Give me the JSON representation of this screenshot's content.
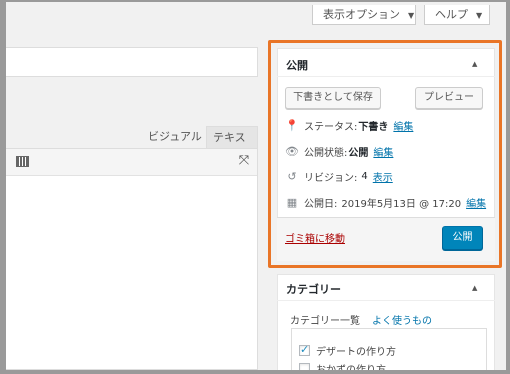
{
  "top": {
    "screen_options": "表示オプション",
    "help": "ヘルプ"
  },
  "editor": {
    "tab_visual": "ビジュアル",
    "tab_text": "テキスト"
  },
  "publish": {
    "title": "公開",
    "save_draft": "下書きとして保存",
    "preview": "プレビュー",
    "status_label": "ステータス:",
    "status_value": "下書き",
    "visibility_label": "公開状態:",
    "visibility_value": "公開",
    "revisions_label": "リビジョン:",
    "revisions_value": "4",
    "revisions_link": "表示",
    "date_label": "公開日:",
    "date_value": "2019年5月13日 @ 17:20",
    "edit": "編集",
    "trash": "ゴミ箱に移動",
    "publish_button": "公開",
    "accent_color": "#e97527",
    "primary_color": "#0085ba"
  },
  "category": {
    "title": "カテゴリー",
    "tab_all": "カテゴリー一覧",
    "tab_popular": "よく使うもの",
    "items": [
      {
        "label": "デザートの作り方",
        "checked": true
      },
      {
        "label": "おかずの作り方",
        "checked": false
      }
    ]
  }
}
